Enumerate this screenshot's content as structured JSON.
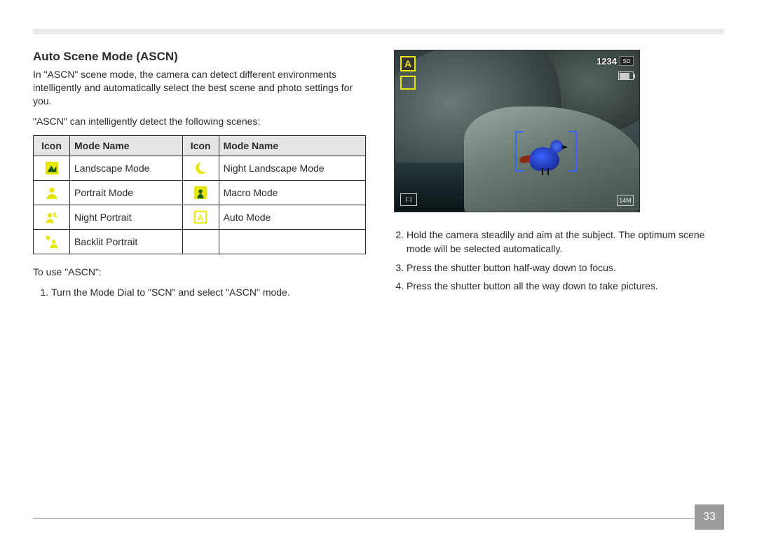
{
  "section_title": "Auto Scene Mode (ASCN)",
  "intro_p1": "In \"ASCN\" scene mode, the camera can detect different environments intelligently and automatically select the best scene and photo settings for you.",
  "intro_p2": "\"ASCN\" can intelligently detect the following scenes:",
  "table": {
    "headers": {
      "c1": "Icon",
      "c2": "Mode Name",
      "c3": "Icon",
      "c4": "Mode Name"
    },
    "rows": [
      {
        "a_name": "Landscape Mode",
        "b_name": "Night Landscape Mode"
      },
      {
        "a_name": "Portrait Mode",
        "b_name": "Macro Mode"
      },
      {
        "a_name": "Night Portrait",
        "b_name": "Auto Mode"
      },
      {
        "a_name": "Backlit Portrait",
        "b_name": ""
      }
    ]
  },
  "to_use_label": "To use \"ASCN\":",
  "steps_left": [
    "Turn the Mode Dial to \"SCN\" and select \"ASCN\" mode."
  ],
  "steps_right": [
    "Hold the camera steadily and aim at the subject. The optimum scene mode will be selected automatically.",
    "Press the shutter button half-way down to focus.",
    "Press the shutter button all the way down to take pictures."
  ],
  "lcd": {
    "mode_letter": "A",
    "counter": "1234",
    "sd": "SD",
    "res": "14M",
    "meter": "[□]"
  },
  "page_number": "33"
}
